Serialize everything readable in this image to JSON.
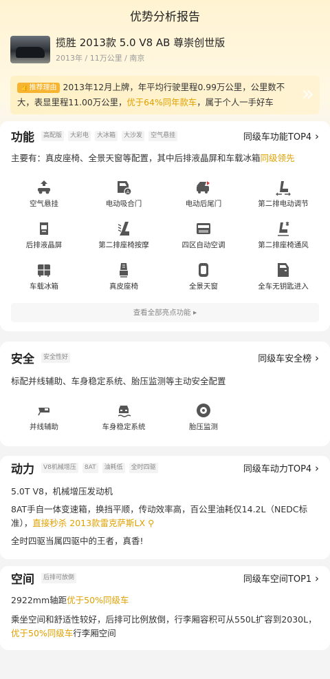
{
  "page": {
    "title": "优势分析报告"
  },
  "car": {
    "name": "揽胜 2013款 5.0 V8 AB 尊崇创世版",
    "meta": "2013年 / 11万公里 / 南京"
  },
  "reason": {
    "badge": "推荐理由",
    "text_a": "2013年12月上牌，年平均行驶里程0.99万公里，公里数不大，表显里程11.00万公里，",
    "highlight": "优于64%同年款车",
    "text_b": "，属于个人一手好车"
  },
  "features": {
    "title": "功能",
    "chips": [
      "高配版",
      "大彩电",
      "大冰箱",
      "大沙发",
      "空气悬挂"
    ],
    "rank": "同级车功能TOP4",
    "desc_a": "主要有：真皮座椅、全景天窗等配置，其中后排液晶屏和车载冰箱",
    "desc_hl": "同级领先",
    "items": [
      "空气悬挂",
      "电动吸合门",
      "电动后尾门",
      "第二排电动调节",
      "后排液晶屏",
      "第二排座椅按摩",
      "四区自动空调",
      "第二排座椅通风",
      "车载冰箱",
      "真皮座椅",
      "全景天窗",
      "全车无钥匙进入"
    ],
    "icons": [
      "suspension-icon",
      "soft-close-door-icon",
      "power-tailgate-icon",
      "seat-adjust-icon",
      "rear-screen-icon",
      "seat-massage-icon",
      "climate-control-icon",
      "seat-ventilation-icon",
      "fridge-icon",
      "leather-seat-icon",
      "sunroof-icon",
      "keyless-entry-icon"
    ],
    "more": "查看全部亮点功能"
  },
  "safety": {
    "title": "安全",
    "chips": [
      "安全性好"
    ],
    "rank": "同级车安全榜",
    "desc": "标配并线辅助、车身稳定系统、胎压监测等主动安全配置",
    "items": [
      "并线辅助",
      "车身稳定系统",
      "胎压监测"
    ],
    "icons": [
      "lane-assist-icon",
      "stability-control-icon",
      "tire-pressure-icon"
    ]
  },
  "power": {
    "title": "动力",
    "chips": [
      "V8机械增压",
      "8AT",
      "油耗低",
      "全时四驱"
    ],
    "rank": "同级车动力TOP4",
    "p1": "5.0T V8，机械增压发动机",
    "p2_a": "8AT手自一体变速箱，换挡平顺，传动效率高，百公里油耗仅14.2L（NEDC标准），",
    "p2_hl": "直接秒杀 2013款雷克萨斯LX",
    "p3": "全时四驱当属四驱中的王者，真香!"
  },
  "space": {
    "title": "空间",
    "chips": [
      "后排可放倒"
    ],
    "rank": "同级车空间TOP1",
    "p1_a": "2922mm轴距",
    "p1_hl": "优于50%同级车",
    "p2_a": "乘坐空间和舒适性较好，后排可比例放倒，行李厢容积可从550L扩容到2030L，",
    "p2_hl": "优于50%同级车",
    "p2_b": "行李厢空间"
  },
  "colors": {
    "accent": "#e0a100",
    "badge": "#f6b431",
    "header_bg": "#fff3d2"
  }
}
